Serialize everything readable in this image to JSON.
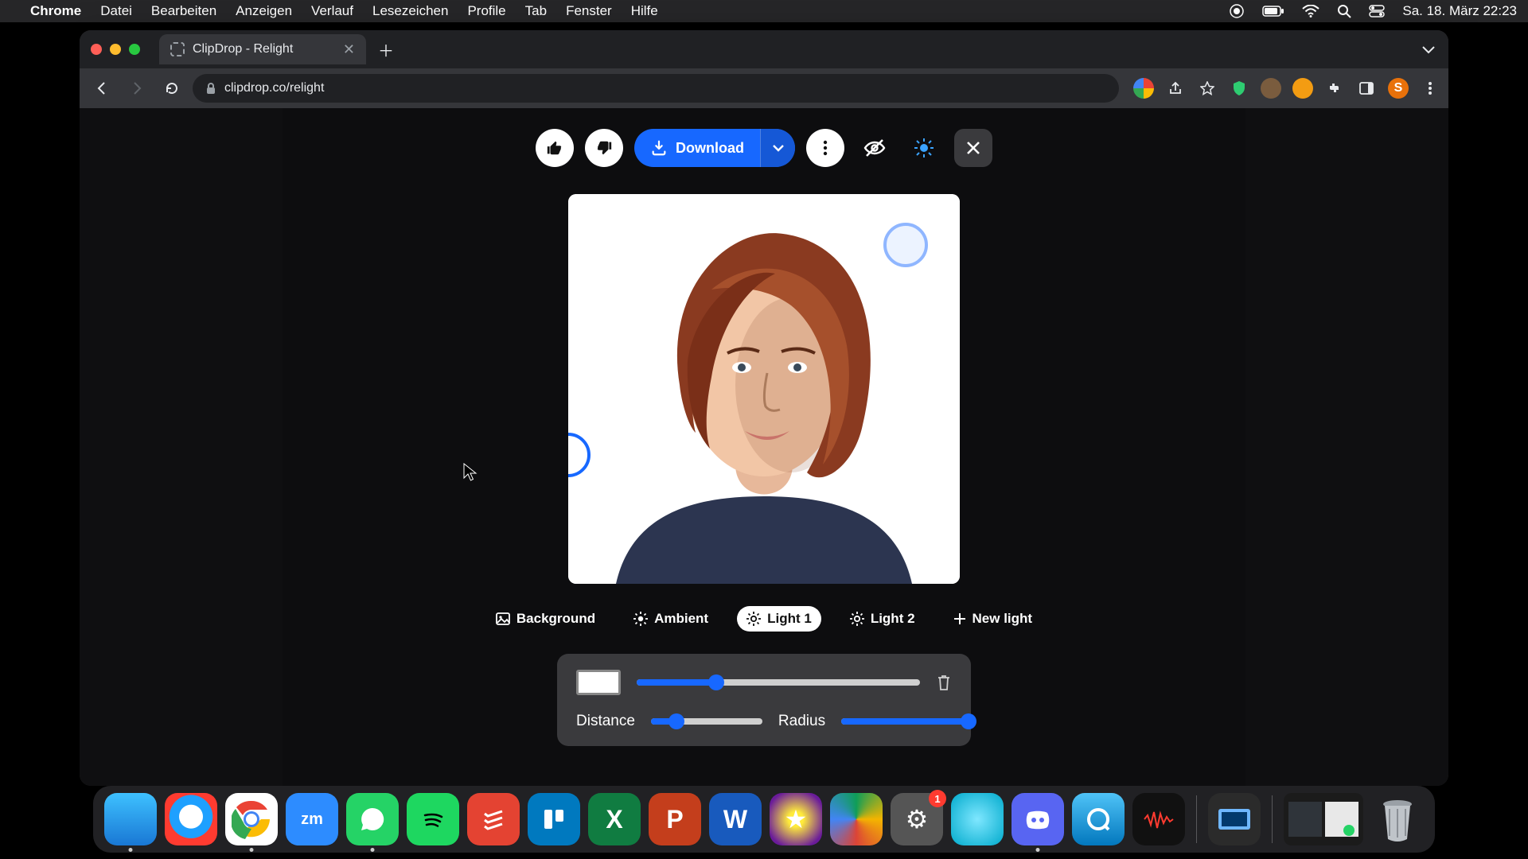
{
  "menubar": {
    "app": "Chrome",
    "items": [
      "Datei",
      "Bearbeiten",
      "Anzeigen",
      "Verlauf",
      "Lesezeichen",
      "Profile",
      "Tab",
      "Fenster",
      "Hilfe"
    ],
    "clock": "Sa. 18. März  22:23"
  },
  "browser": {
    "tab_title": "ClipDrop - Relight",
    "url": "clipdrop.co/relight",
    "profile_initial": "S"
  },
  "actions": {
    "download": "Download"
  },
  "light_tabs": {
    "background": "Background",
    "ambient": "Ambient",
    "light1": "Light 1",
    "light2": "Light 2",
    "newlight": "New light"
  },
  "controls": {
    "distance_label": "Distance",
    "radius_label": "Radius",
    "color": "#ffffff",
    "intensity_pct": 28,
    "distance_pct": 23,
    "radius_pct": 100
  },
  "dock": {
    "settings_badge": "1"
  }
}
